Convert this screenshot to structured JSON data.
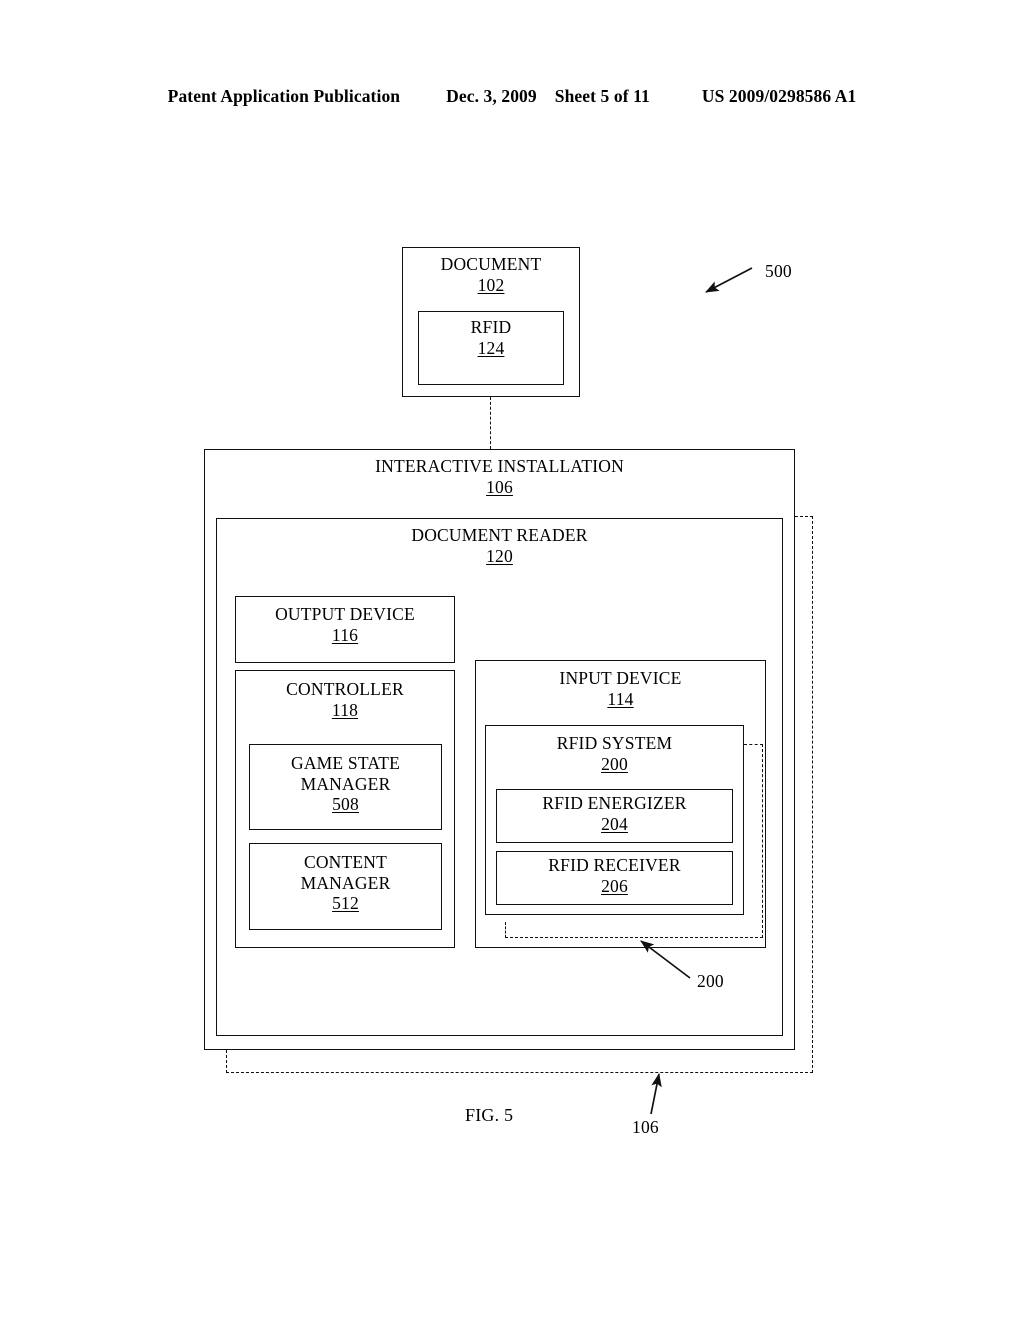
{
  "header": {
    "publication": "Patent Application Publication",
    "date": "Dec. 3, 2009",
    "sheet": "Sheet 5 of 11",
    "patent_number": "US 2009/0298586 A1"
  },
  "figure": {
    "caption": "FIG. 5",
    "system_ref": "500",
    "callout_rfid_system_ref": "200",
    "callout_installation_ref": "106"
  },
  "blocks": {
    "document": {
      "title": "DOCUMENT",
      "ref": "102"
    },
    "rfid_tag": {
      "title": "RFID",
      "ref": "124"
    },
    "interactive_installation": {
      "title": "INTERACTIVE INSTALLATION",
      "ref": "106"
    },
    "document_reader": {
      "title": "DOCUMENT READER",
      "ref": "120"
    },
    "output_device": {
      "title": "OUTPUT DEVICE",
      "ref": "116"
    },
    "controller": {
      "title": "CONTROLLER",
      "ref": "118"
    },
    "game_state_manager": {
      "title_line1": "GAME STATE",
      "title_line2": "MANAGER",
      "ref": "508"
    },
    "content_manager": {
      "title_line1": "CONTENT",
      "title_line2": "MANAGER",
      "ref": "512"
    },
    "input_device": {
      "title": "INPUT DEVICE",
      "ref": "114"
    },
    "rfid_system": {
      "title": "RFID SYSTEM",
      "ref": "200"
    },
    "rfid_energizer": {
      "title": "RFID ENERGIZER",
      "ref": "204"
    },
    "rfid_receiver": {
      "title": "RFID RECEIVER",
      "ref": "206"
    }
  }
}
